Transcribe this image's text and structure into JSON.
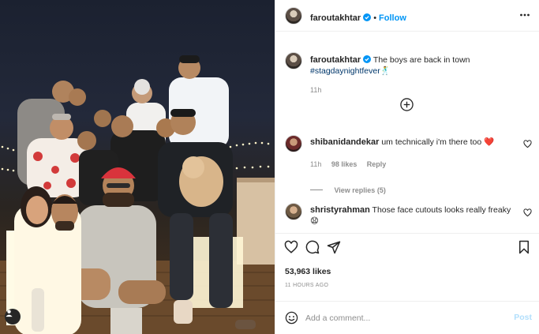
{
  "post_image": {
    "alt_icon": "user-tag-icon"
  },
  "header": {
    "username": "faroutakhtar",
    "separator": "•",
    "follow_label": "Follow",
    "more_icon": "more-options-icon"
  },
  "caption": {
    "username": "faroutakhtar",
    "text": "The boys are back in town",
    "hashtag": "#stagdaynightfever",
    "emoji": "🕺",
    "time": "11h"
  },
  "load_more_icon": "plus-circle-icon",
  "comments": [
    {
      "username": "shibanidandekar",
      "text": "um technically i'm there too",
      "emoji": "❤️",
      "time": "11h",
      "likes": "98 likes",
      "reply_label": "Reply",
      "view_replies": "View replies (5)"
    },
    {
      "username": "shristyrahman",
      "text": "Those face cutouts looks really freaky",
      "emoji": "😧"
    }
  ],
  "actions": {
    "like_icon": "heart-icon",
    "comment_icon": "comment-icon",
    "share_icon": "share-icon",
    "save_icon": "bookmark-icon"
  },
  "likes_count": "53,963 likes",
  "time_ago": "11 HOURS AGO",
  "comment_box": {
    "placeholder": "Add a comment...",
    "post_label": "Post"
  },
  "colors": {
    "accent": "#0095f6",
    "hashtag": "#00376b",
    "muted": "#8e8e8e",
    "heart_red": "#ed4956",
    "post_disabled": "#b2dffc"
  }
}
